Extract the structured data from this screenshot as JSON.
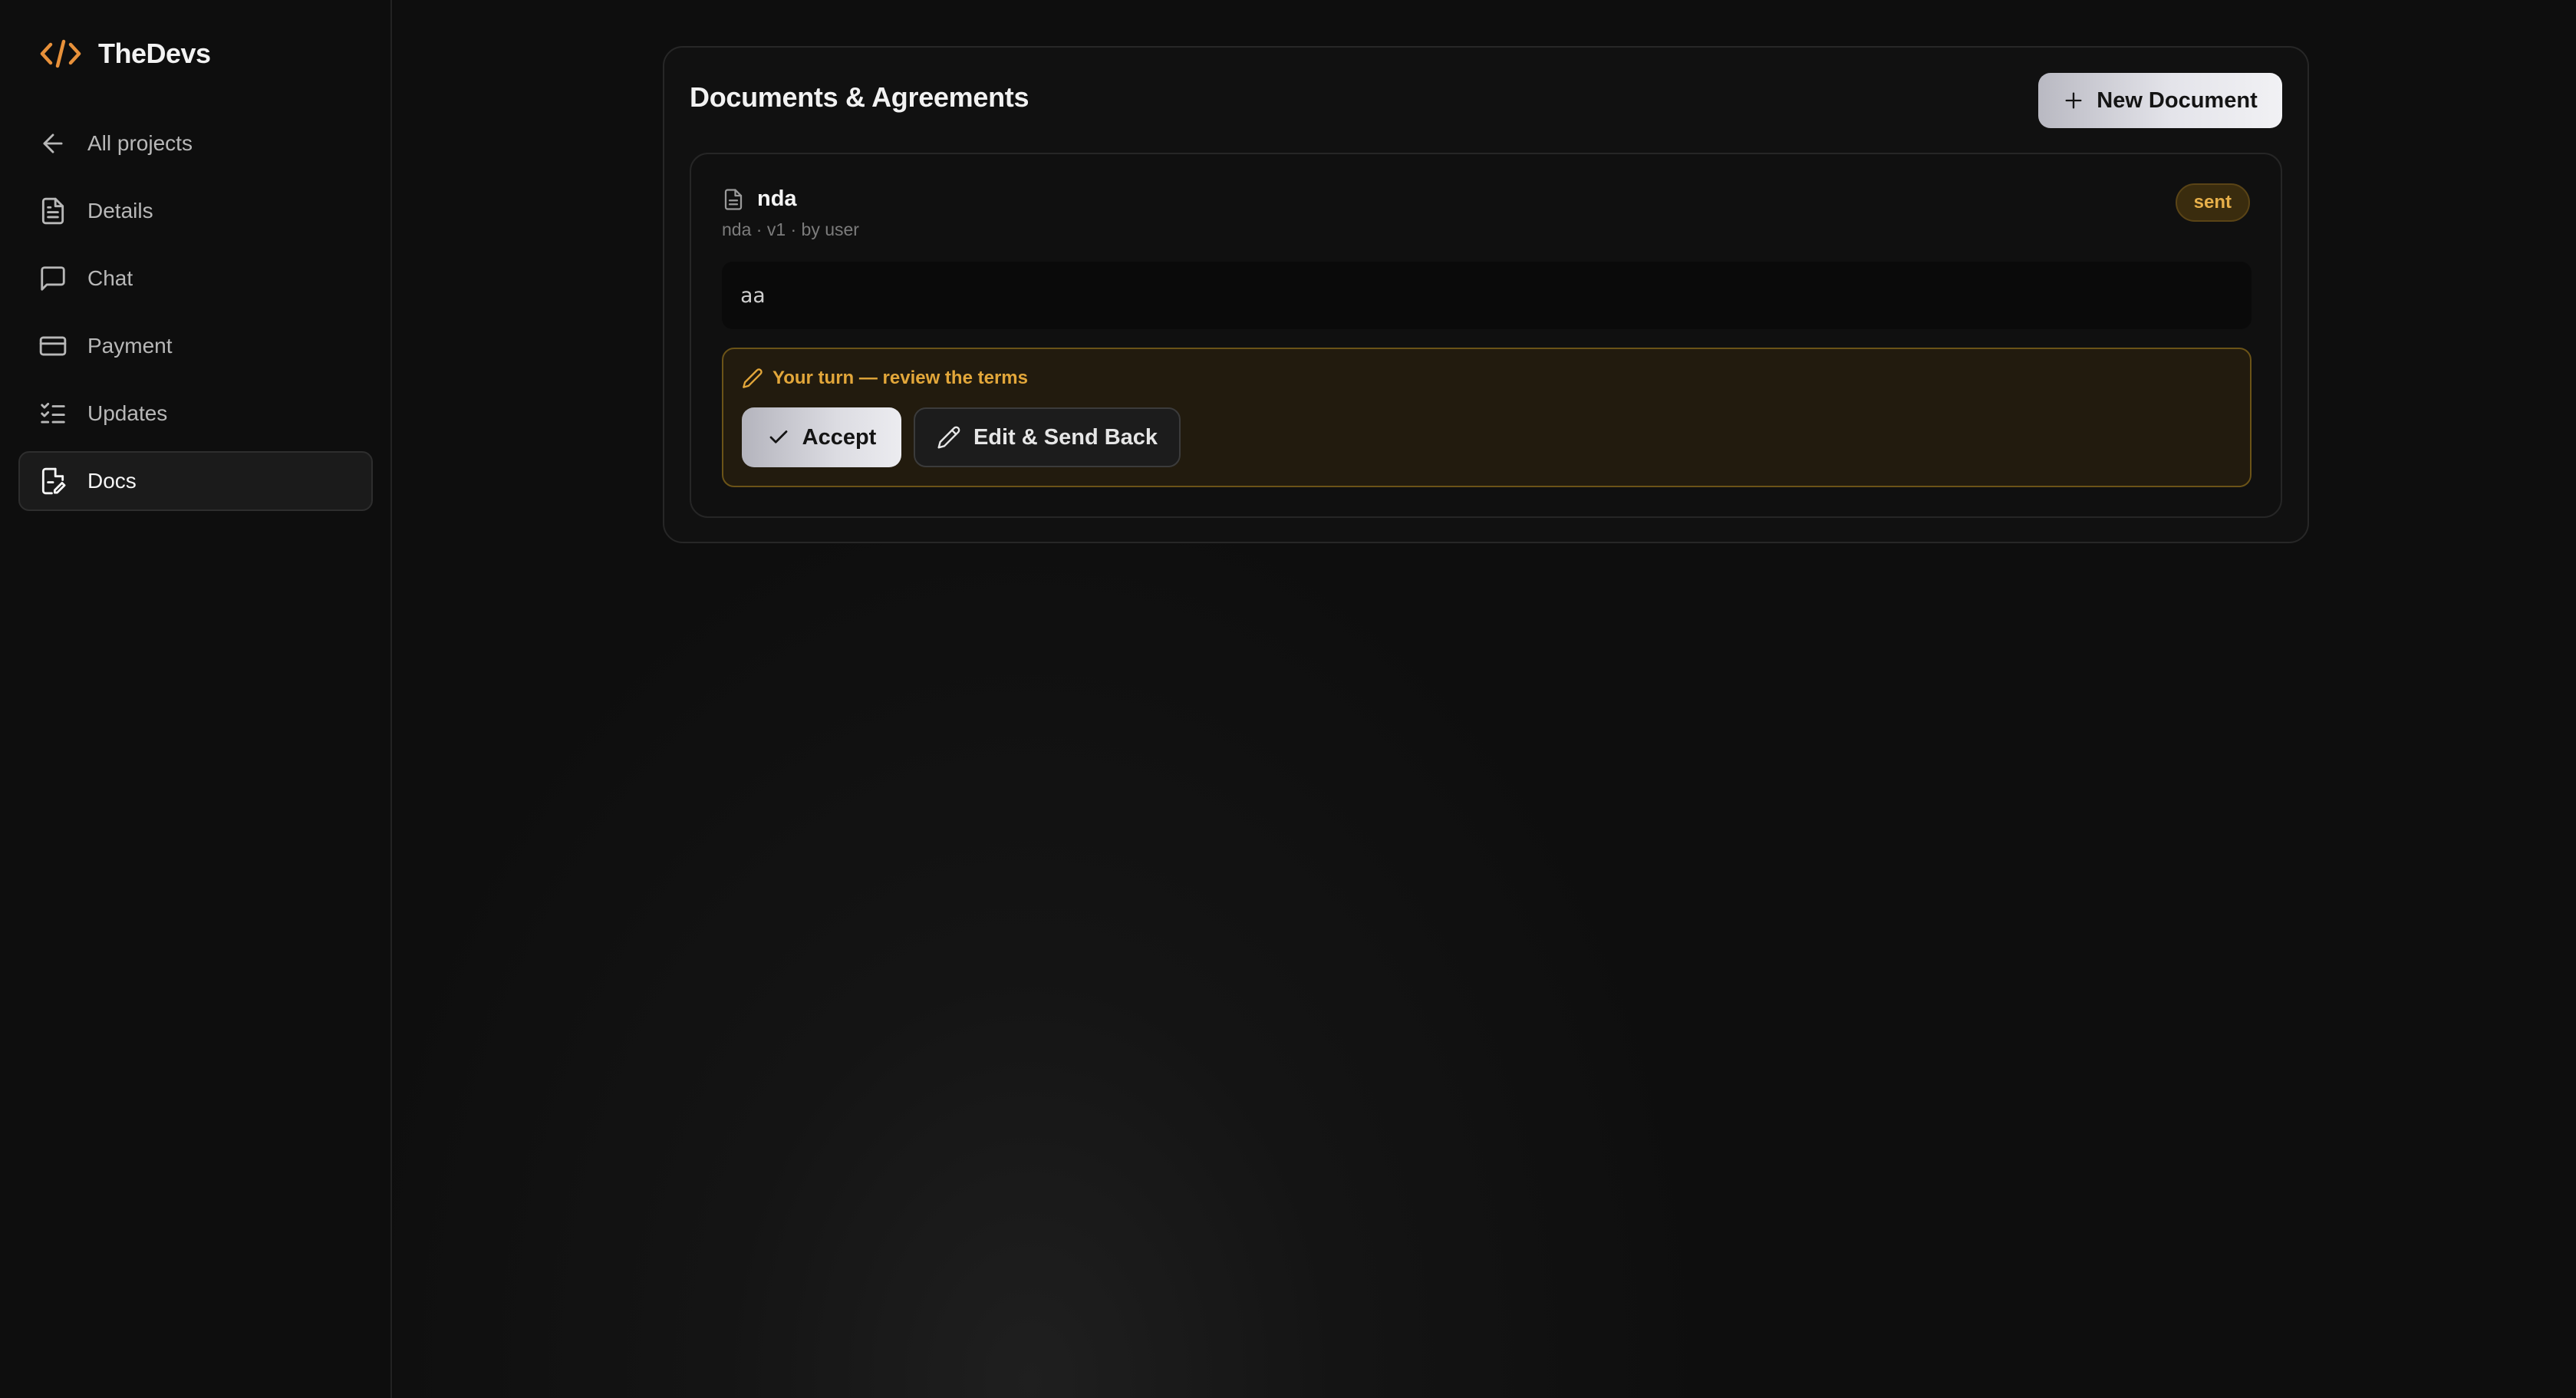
{
  "brand": {
    "name": "TheDevs",
    "accent": "#e8913a"
  },
  "sidebar": {
    "items": [
      {
        "label": "All projects",
        "icon": "arrow-left-icon",
        "active": false
      },
      {
        "label": "Details",
        "icon": "file-text-icon",
        "active": false
      },
      {
        "label": "Chat",
        "icon": "message-square-icon",
        "active": false
      },
      {
        "label": "Payment",
        "icon": "credit-card-icon",
        "active": false
      },
      {
        "label": "Updates",
        "icon": "list-checks-icon",
        "active": false
      },
      {
        "label": "Docs",
        "icon": "file-edit-icon",
        "active": true
      }
    ]
  },
  "documents": {
    "title": "Documents & Agreements",
    "new_button_label": "New Document",
    "items": [
      {
        "name": "nda",
        "meta": "nda · v1 · by user",
        "status": "sent",
        "status_color": "#e7b04a",
        "content": "aa",
        "review": {
          "notice": "Your turn — review the terms",
          "accept_label": "Accept",
          "edit_label": "Edit & Send Back"
        }
      }
    ]
  }
}
